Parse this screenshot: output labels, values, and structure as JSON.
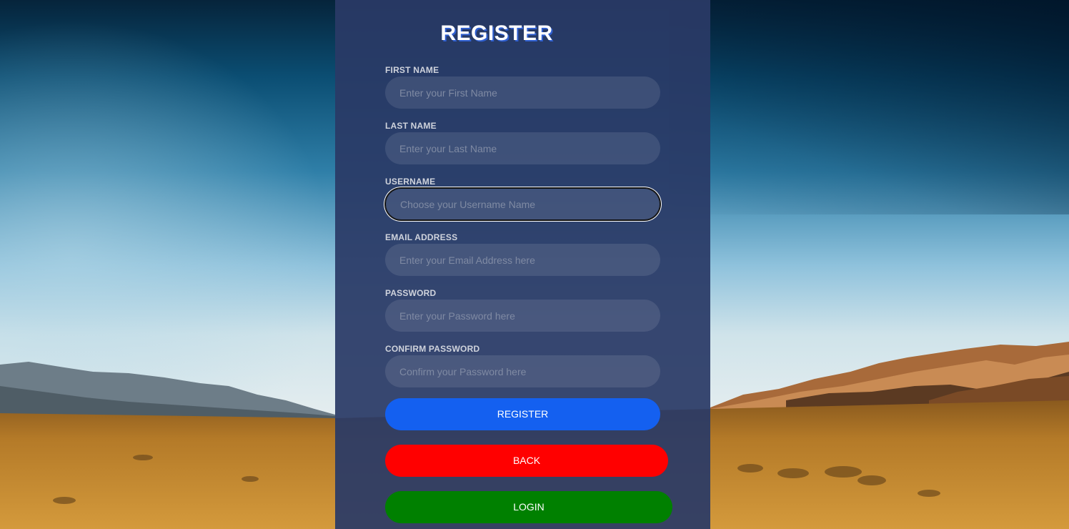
{
  "page": {
    "title": "REGISTER"
  },
  "form": {
    "fields": [
      {
        "label": "FIRST NAME",
        "placeholder": "Enter your First Name",
        "value": ""
      },
      {
        "label": "LAST NAME",
        "placeholder": "Enter your Last Name",
        "value": ""
      },
      {
        "label": "USERNAME",
        "placeholder": "Choose your Username Name",
        "value": ""
      },
      {
        "label": "EMAIL ADDRESS",
        "placeholder": "Enter your Email Address here",
        "value": ""
      },
      {
        "label": "PASSWORD",
        "placeholder": "Enter your Password here",
        "value": ""
      },
      {
        "label": "CONFIRM PASSWORD",
        "placeholder": "Confirm your Password here",
        "value": ""
      }
    ],
    "focused_field": "USERNAME"
  },
  "buttons": {
    "register": {
      "label": "REGISTER",
      "color": "#1460f0"
    },
    "back": {
      "label": "BACK",
      "color": "#ff0000"
    },
    "login": {
      "label": "LOGIN",
      "color": "#008000"
    }
  },
  "colors": {
    "panel": "#2a3a66",
    "title_shadow": "#2f5fd0"
  },
  "background": {
    "scene": "desert-road-landscape"
  }
}
